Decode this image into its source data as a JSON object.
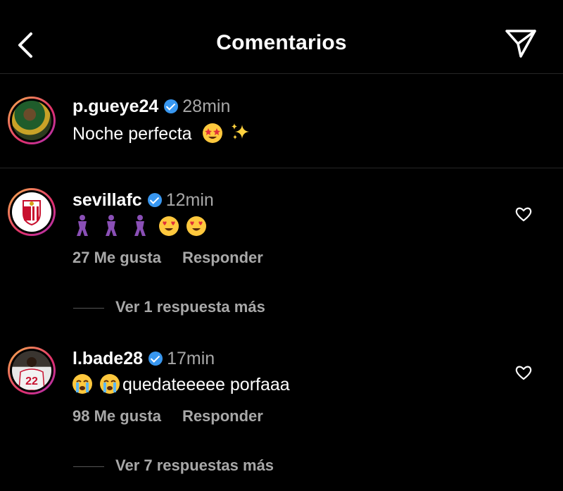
{
  "header": {
    "title": "Comentarios",
    "back_icon": "chevron-left-icon",
    "share_icon": "paper-plane-icon"
  },
  "comments": [
    {
      "username": "p.gueye24",
      "verified": true,
      "time": "28min",
      "text": "Noche perfecta",
      "emojis": [
        "star-struck",
        "sparkles"
      ]
    },
    {
      "username": "sevillafc",
      "verified": true,
      "time": "12min",
      "emojis": [
        "dancing-figure",
        "dancing-figure",
        "dancing-figure",
        "heart-eyes",
        "heart-eyes"
      ],
      "likes": "27 Me gusta",
      "reply_label": "Responder",
      "view_replies": "Ver 1 respuesta más"
    },
    {
      "username": "l.bade28",
      "verified": true,
      "time": "17min",
      "text": "quedateeeee porfaaa",
      "emojis": [
        "crying",
        "crying"
      ],
      "likes": "98 Me gusta",
      "reply_label": "Responder",
      "view_replies": "Ver 7 respuestas más"
    }
  ],
  "colors": {
    "background": "#000000",
    "secondary_text": "#a8a8a8",
    "verified_badge": "#3897f0",
    "divider": "#262626"
  }
}
